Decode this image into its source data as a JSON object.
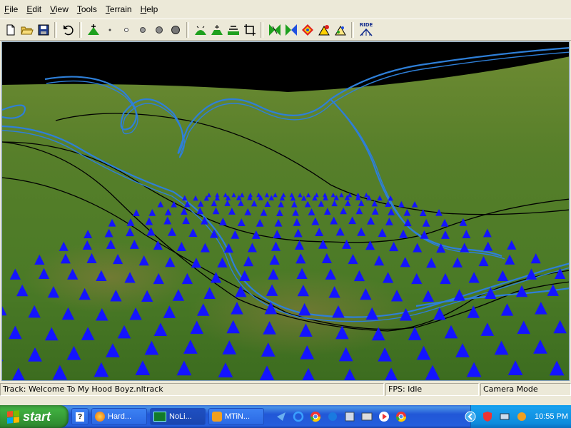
{
  "menu": [
    {
      "label": "File",
      "hot": "F",
      "rest": "ile"
    },
    {
      "label": "Edit",
      "hot": "E",
      "rest": "dit"
    },
    {
      "label": "View",
      "hot": "V",
      "rest": "iew"
    },
    {
      "label": "Tools",
      "hot": "T",
      "rest": "ools"
    },
    {
      "label": "Terrain",
      "hot": "T",
      "rest": "errain"
    },
    {
      "label": "Help",
      "hot": "H",
      "rest": "elp"
    }
  ],
  "toolbar": {
    "ride_label": "RIDE",
    "icons": [
      "new-file-icon",
      "open-folder-icon",
      "save-icon",
      "undo-icon",
      "terrain-raise-icon",
      "brush-size-1-icon",
      "brush-size-2-icon",
      "brush-size-3-icon",
      "brush-size-4-icon",
      "brush-size-5-icon",
      "terrain-smooth-icon",
      "terrain-flatten-icon",
      "terrain-level-icon",
      "crop-icon",
      "node-insert-icon",
      "node-delete-icon",
      "node-move-icon",
      "node-raise-icon",
      "node-lower-icon",
      "ride-icon"
    ]
  },
  "status": {
    "track": "Track: Welcome To My Hood Boyz.nltrack",
    "fps": "FPS: Idle",
    "mode": "Camera Mode"
  },
  "taskbar": {
    "start_label": "start",
    "tasks": [
      "Hard...",
      "NoLi...",
      "MTiN..."
    ],
    "clock": "10:55 PM"
  },
  "colors": {
    "sky": "#000000",
    "track": "#2e7fd8",
    "markers": "#1414ff",
    "terrain": "#4f7a2a"
  }
}
